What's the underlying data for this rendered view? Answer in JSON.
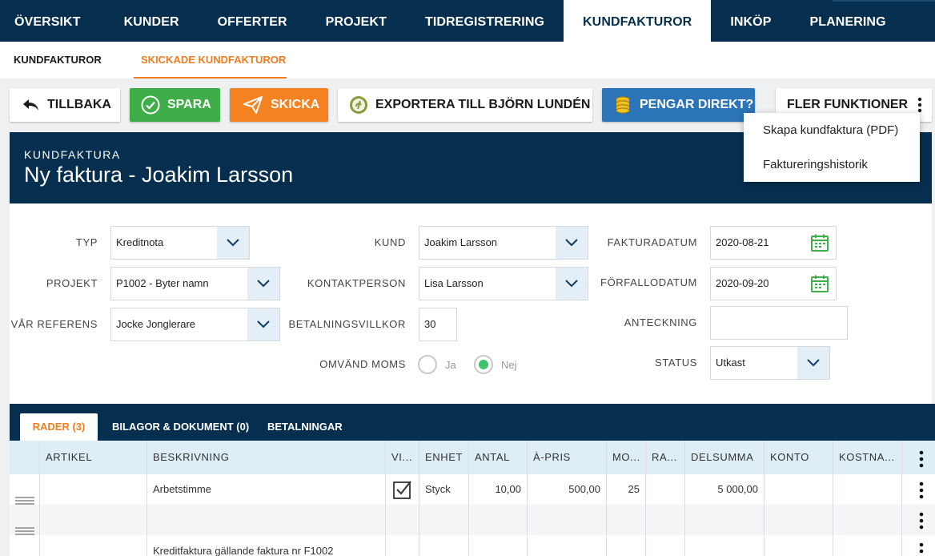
{
  "nav": {
    "items": [
      "ÖVERSIKT",
      "KUNDER",
      "OFFERTER",
      "PROJEKT",
      "TIDREGISTRERING",
      "KUNDFAKTUROR",
      "INKÖP",
      "PLANERING"
    ],
    "active_index": 5
  },
  "subnav": {
    "items": [
      "KUNDFAKTUROR",
      "SKICKADE KUNDFAKTUROR"
    ],
    "active_index": 1
  },
  "toolbar": {
    "back_label": "TILLBAKA",
    "save_label": "SPARA",
    "send_label": "SKICKA",
    "export_label": "EXPORTERA TILL BJÖRN LUNDÉN",
    "money_label": "PENGAR DIREKT?",
    "more_label": "FLER FUNKTIONER"
  },
  "menu": {
    "items": [
      "Skapa kundfaktura (PDF)",
      "Faktureringshistorik"
    ]
  },
  "header": {
    "subtitle": "KUNDFAKTURA",
    "title": "Ny faktura - Joakim Larsson"
  },
  "form": {
    "typ_label": "TYP",
    "typ_value": "Kreditnota",
    "projekt_label": "PROJEKT",
    "projekt_value": "P1002 - Byter namn",
    "referens_label": "VÅR REFERENS",
    "referens_value": "Jocke Jonglerare",
    "kund_label": "KUND",
    "kund_value": "Joakim Larsson",
    "kontakt_label": "KONTAKTPERSON",
    "kontakt_value": "Lisa Larsson",
    "villkor_label": "BETALNINGSVILLKOR",
    "villkor_value": "30",
    "moms_label": "OMVÄND MOMS",
    "moms_ja": "Ja",
    "moms_nej": "Nej",
    "fakturadatum_label": "FAKTURADATUM",
    "fakturadatum_value": "2020-08-21",
    "forfallodatum_label": "FÖRFALLODATUM",
    "forfallodatum_value": "2020-09-20",
    "anteckning_label": "ANTECKNING",
    "anteckning_value": "",
    "status_label": "STATUS",
    "status_value": "Utkast"
  },
  "tabs": {
    "items": [
      "RADER (3)",
      "BILAGOR & DOKUMENT (0)",
      "BETALNINGAR"
    ],
    "active_index": 0
  },
  "table": {
    "headers": [
      "ARTIKEL",
      "BESKRIVNING",
      "VI...",
      "ENHET",
      "ANTAL",
      "À-PRIS",
      "MO...",
      "RA...",
      "DELSUMMA",
      "KONTO",
      "KOSTNA..."
    ],
    "rows": [
      {
        "artikel": "",
        "beskrivning": "Arbetstimme",
        "visa": true,
        "enhet": "Styck",
        "antal": "10,00",
        "apris": "500,00",
        "moms": "25",
        "rabatt": "",
        "delsumma": "5 000,00",
        "konto": "",
        "kostnad": ""
      },
      {
        "artikel": "",
        "beskrivning": "",
        "visa": false,
        "enhet": "",
        "antal": "",
        "apris": "",
        "moms": "",
        "rabatt": "",
        "delsumma": "",
        "konto": "",
        "kostnad": ""
      },
      {
        "artikel": "",
        "beskrivning": "Kreditfaktura gällande faktura nr F1002",
        "visa": false,
        "enhet": "",
        "antal": "",
        "apris": "",
        "moms": "",
        "rabatt": "",
        "delsumma": "",
        "konto": "",
        "kostnad": ""
      }
    ]
  },
  "colors": {
    "navy": "#062f4f",
    "orange": "#f07d1f",
    "green": "#3fae49",
    "blue": "#2b74b8",
    "header_row": "#deedf6"
  }
}
